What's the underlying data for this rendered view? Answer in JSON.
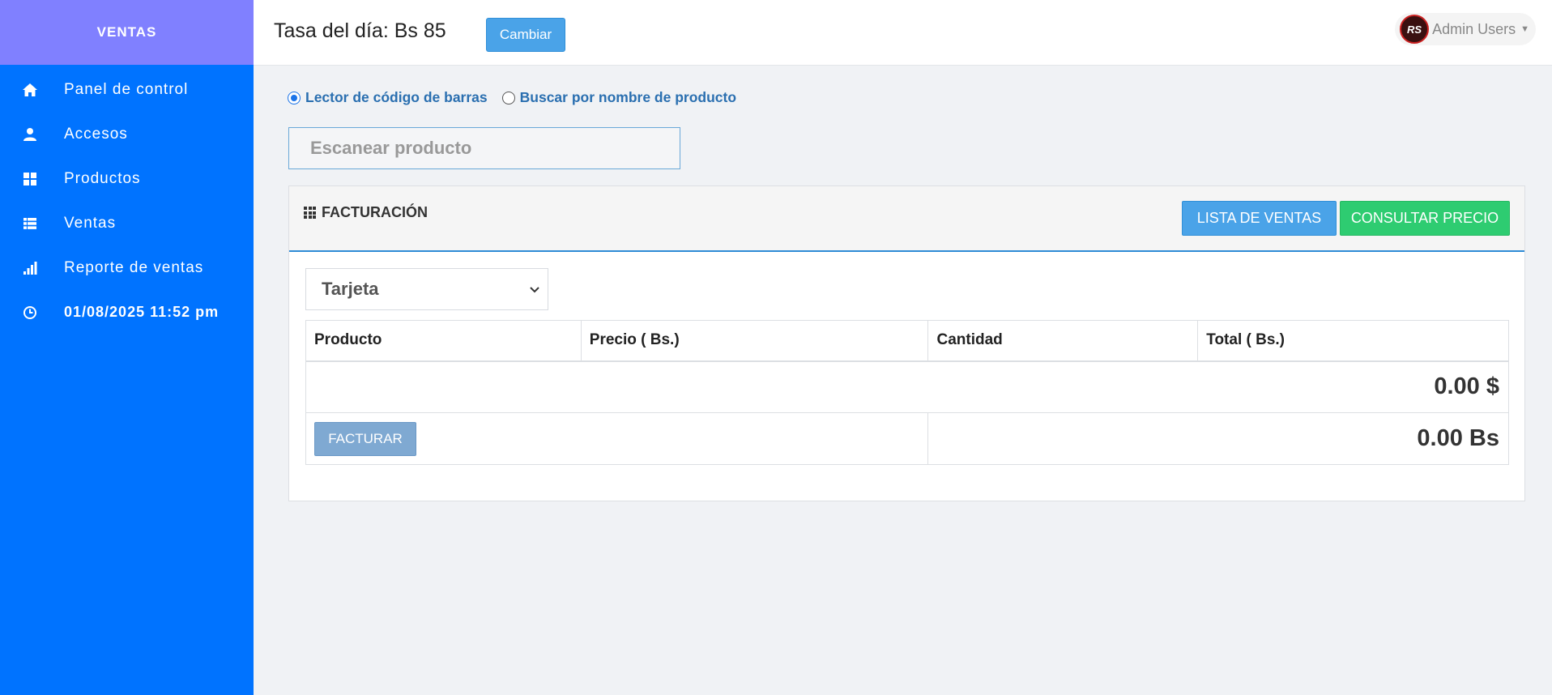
{
  "sidebar": {
    "brand": "VENTAS",
    "items": [
      {
        "label": "Panel de control",
        "icon": "home-icon"
      },
      {
        "label": "Accesos",
        "icon": "user-icon"
      },
      {
        "label": "Productos",
        "icon": "grid-icon"
      },
      {
        "label": "Ventas",
        "icon": "list-icon"
      },
      {
        "label": "Reporte de ventas",
        "icon": "signal-icon"
      },
      {
        "label": "01/08/2025 11:52 pm",
        "icon": "clock-icon"
      }
    ]
  },
  "header": {
    "rate_label": "Tasa del día: Bs 85",
    "change_button": "Cambiar",
    "user_name": "Admin Users",
    "avatar_text": "RS"
  },
  "search": {
    "mode_options": [
      "Lector de código de barras",
      "Buscar por nombre de producto"
    ],
    "selected_mode": "Lector de código de barras",
    "placeholder": "Escanear producto"
  },
  "billing": {
    "title": "FACTURACIÓN",
    "sales_list_button": "LISTA DE VENTAS",
    "price_check_button": "CONSULTAR PRECIO",
    "payment_method": "Tarjeta",
    "columns": [
      "Producto",
      "Precio ( Bs.)",
      "Cantidad",
      "Total ( Bs.)"
    ],
    "total_usd": "0.00 $",
    "total_bs": "0.00 Bs",
    "invoice_button": "FACTURAR"
  },
  "colors": {
    "sidebar": "#0073ff",
    "brand": "#8080ff",
    "primary": "#4aa3e8",
    "success": "#2ecc71"
  }
}
